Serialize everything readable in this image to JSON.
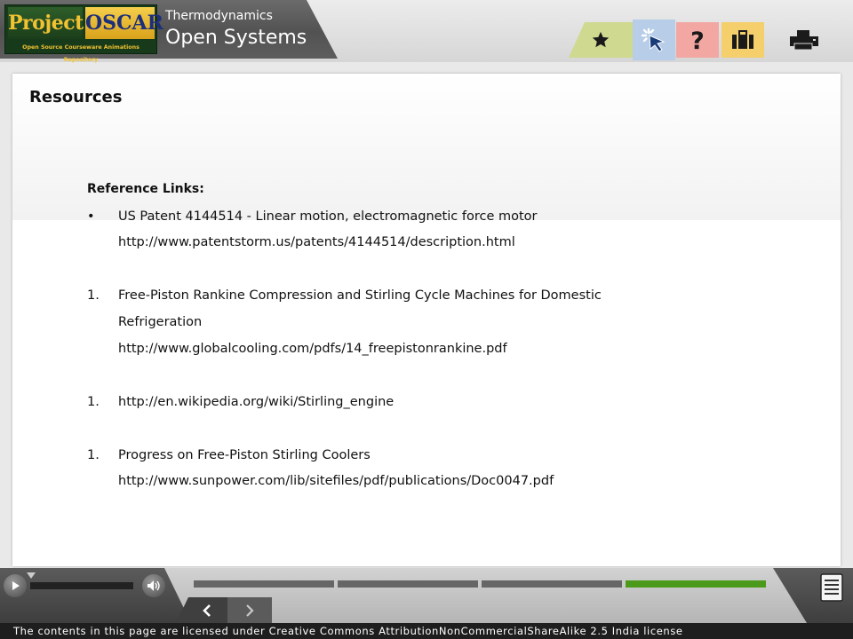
{
  "header": {
    "logo": {
      "project": "Project",
      "oscar": "OSCAR",
      "tagline": "Open Source Courseware Animations Repository"
    },
    "subject": "Thermodynamics",
    "topic": "Open Systems",
    "tabs": [
      {
        "icon": "star-icon",
        "color": "#cfd98f"
      },
      {
        "icon": "cursor-click-icon",
        "color": "#b7cde8"
      },
      {
        "icon": "question-mark-icon",
        "color": "#f2a7a2"
      },
      {
        "icon": "briefcase-icon",
        "color": "#f4cf6b"
      },
      {
        "icon": "printer-icon"
      }
    ]
  },
  "content": {
    "title": "Resources",
    "heading": "Reference Links:",
    "refs": [
      {
        "marker": "•",
        "lines": [
          "US Patent 4144514 - Linear motion, electromagnetic force motor",
          "http://www.patentstorm.us/patents/4144514/description.html"
        ]
      },
      {
        "marker": "1.",
        "lines": [
          "Free-Piston Rankine Compression and Stirling Cycle Machines for Domestic",
          "Refrigeration",
          "http://www.globalcooling.com/pdfs/14_freepistonrankine.pdf"
        ]
      },
      {
        "marker": "1.",
        "lines": [
          "http://en.wikipedia.org/wiki/Stirling_engine"
        ]
      },
      {
        "marker": "1.",
        "lines": [
          "Progress on Free-Piston Stirling Coolers",
          "http://www.sunpower.com/lib/sitefiles/pdf/publications/Doc0047.pdf"
        ]
      }
    ]
  },
  "footer": {
    "progress": {
      "segments": 4,
      "current": 4,
      "active_color": "#4c9a1c",
      "inactive_color": "#666666"
    },
    "license": "The contents in this page are licensed under Creative Commons AttributionNonCommercialShareAlike 2.5 India license"
  }
}
